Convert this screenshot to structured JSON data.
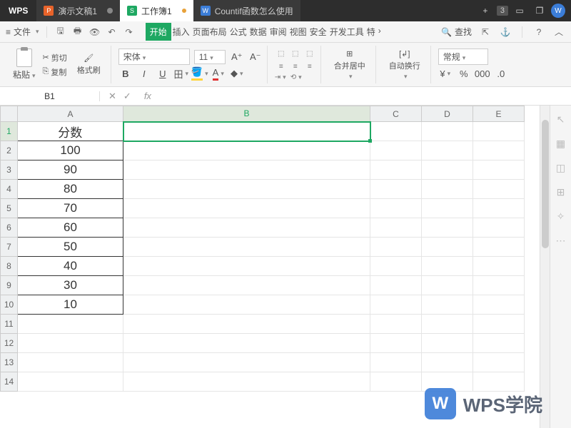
{
  "titlebar": {
    "logo": "WPS",
    "tabs": [
      {
        "icon": "P",
        "label": "演示文稿1"
      },
      {
        "icon": "S",
        "label": "工作簿1"
      },
      {
        "icon": "W",
        "label": "Countif函数怎么使用"
      }
    ],
    "tab_count": "3"
  },
  "menubar": {
    "file": "文件",
    "tabs": [
      "开始",
      "插入",
      "页面布局",
      "公式",
      "数据",
      "审阅",
      "视图",
      "安全",
      "开发工具",
      "特"
    ],
    "search": "查找"
  },
  "ribbon": {
    "paste": "粘贴",
    "cut": "剪切",
    "copy": "复制",
    "format_painter": "格式刷",
    "font_name": "宋体",
    "font_size": "11",
    "merge": "合并居中",
    "wrap": "自动换行",
    "number_format": "常规"
  },
  "namebox": {
    "ref": "B1",
    "fx": "fx"
  },
  "columns": [
    "A",
    "B",
    "C",
    "D",
    "E"
  ],
  "rows": [
    "1",
    "2",
    "3",
    "4",
    "5",
    "6",
    "7",
    "8",
    "9",
    "10",
    "11",
    "12",
    "13",
    "14"
  ],
  "data": {
    "A1": "分数",
    "A2": "100",
    "A3": "90",
    "A4": "80",
    "A5": "70",
    "A6": "60",
    "A7": "50",
    "A8": "40",
    "A9": "30",
    "A10": "10"
  },
  "watermark": {
    "logo": "W",
    "text": "WPS学院"
  }
}
